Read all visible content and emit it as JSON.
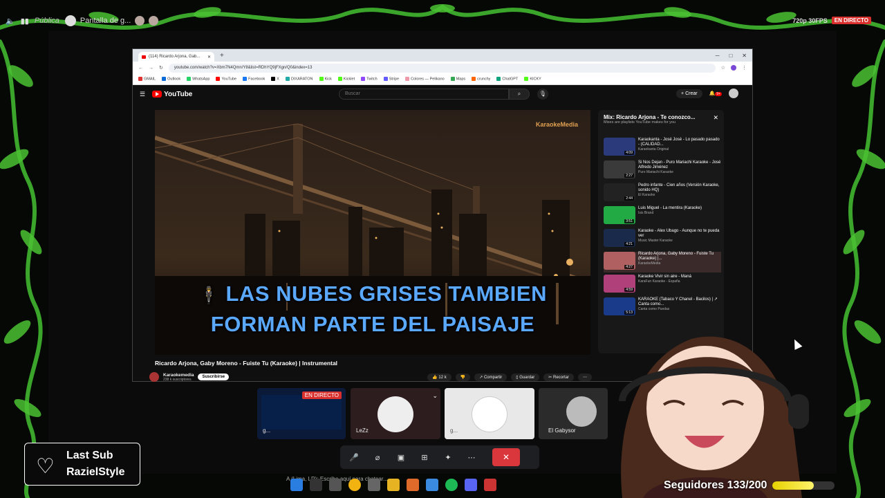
{
  "discord": {
    "visibility": "Pública",
    "screen_share_label": "Pantalla de g...",
    "quality": "720p 30FPS",
    "live": "EN DIRECTO"
  },
  "browser": {
    "tab_title": "(114) Ricardo Arjona, Gab...",
    "url": "youtube.com/watch?v=Xbm7N4Qmn/Y8&list=RDhYQ9jFXgn/Q0&index=13",
    "bookmarks": [
      "GMAIL",
      "Outlook",
      "WhatsApp",
      "YouTube",
      "Facebook",
      "X",
      "DIXARATON",
      "Kick",
      "Kicklet",
      "Twitch",
      "Stripe",
      "Colores — Pelikano",
      "Maps",
      "crunchy",
      "ChatGPT",
      "KICKY"
    ]
  },
  "youtube": {
    "logo": "YouTube",
    "search_placeholder": "Buscar",
    "create": "Crear",
    "notif_count": "9+",
    "lyrics_line1": "LAS NUBES GRISES TAMBIEN",
    "lyrics_line2": "FORMAN PARTE DEL PAISAJE",
    "watermark": "KaraokeMedia",
    "video_title": "Ricardo Arjona, Gaby Moreno - Fuiste Tu (Karaoke) | Instrumental",
    "channel": "Karaokemedia",
    "subs": "238 k suscriptores",
    "subscribe": "Suscribirse",
    "likes": "12 k",
    "share": "Compartir",
    "save": "Guardar",
    "clip": "Recortar",
    "playlist": {
      "title": "Mix: Ricardo Arjona - Te conozco...",
      "subtitle": "Mixes are playlists YouTube makes for you",
      "items": [
        {
          "title": "Karaokanta - José José - Lo pasado pasado - (CALIDAD...",
          "channel": "Karaokanta Original",
          "duration": "4:09",
          "color": "#2a3a7a"
        },
        {
          "title": "Si Nos Dejan - Puro Mariachi Karaoke - José Alfredo Jiménez",
          "channel": "Puro Mariachi Karaoke",
          "duration": "2:27",
          "color": "#3a3a3a"
        },
        {
          "title": "Pedro infante - Cien años (Versión Karaoke, sonido HQ)",
          "channel": "El Karaoke",
          "duration": "2:44",
          "color": "#222222"
        },
        {
          "title": "Luis Miguel - La mentira (Karaoke)",
          "channel": "Isis Brand",
          "duration": "3:51",
          "color": "#22aa44"
        },
        {
          "title": "Karaoke - Alex Ubago - Aunque no te pueda ver",
          "channel": "Music Master Karaoke",
          "duration": "4:21",
          "color": "#1a2a4a"
        },
        {
          "title": "Ricardo Arjona, Gaby Moreno - Fuiste Tu (Karaoke) |...",
          "channel": "KaraokeMedia",
          "duration": "4:27",
          "color": "#b06060"
        },
        {
          "title": "Karaoke Vivir sin aire - Maná",
          "channel": "KaraFun Karaoke - España",
          "duration": "4:59",
          "color": "#b0407a"
        },
        {
          "title": "KARAOKE (Tabaco Y Chanel - Bacilos) | ↗ Canta como...",
          "channel": "Canta como Puedas",
          "duration": "5:13",
          "color": "#1a3a8a"
        }
      ]
    }
  },
  "call": {
    "tiles": [
      {
        "name": "g...",
        "live": "EN DIRECTO"
      },
      {
        "name": "LeZz"
      },
      {
        "name": "g..."
      },
      {
        "name": "El Gabysor"
      }
    ]
  },
  "overlay": {
    "last_sub_label": "Last Sub",
    "last_sub_name": "RazielStyle",
    "followers": "Seguidores 133/200",
    "followers_progress": 0.665,
    "chat_hint": "A (Lima, LR): Escribe aquí para chatear..."
  }
}
